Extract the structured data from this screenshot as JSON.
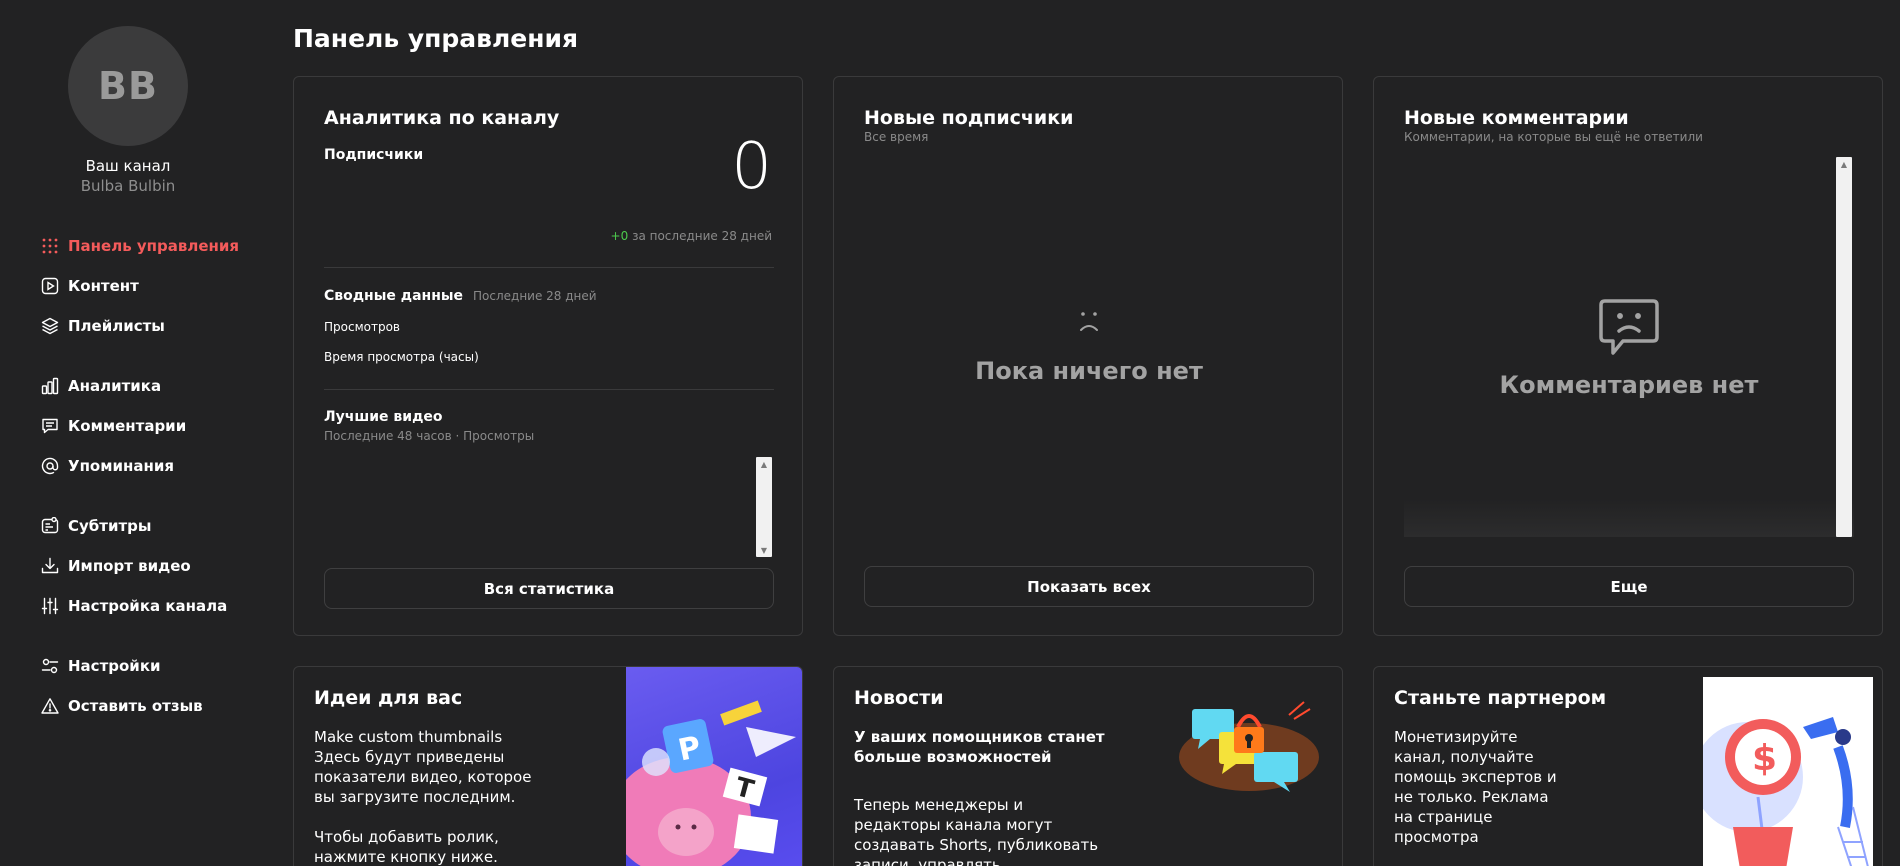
{
  "sidebar": {
    "avatar_initials": "BB",
    "channel_label": "Ваш канал",
    "channel_handle": "Bulba Bulbin",
    "items": [
      {
        "label": "Панель управления",
        "icon": "grid-dots-icon",
        "active": true
      },
      {
        "label": "Контент",
        "icon": "play-square-icon"
      },
      {
        "label": "Плейлисты",
        "icon": "layers-icon"
      },
      {
        "label": "Аналитика",
        "icon": "bar-chart-icon"
      },
      {
        "label": "Комментарии",
        "icon": "comment-icon"
      },
      {
        "label": "Упоминания",
        "icon": "at-sign-icon"
      },
      {
        "label": "Субтитры",
        "icon": "subtitles-icon"
      },
      {
        "label": "Импорт видео",
        "icon": "download-icon"
      },
      {
        "label": "Настройка канала",
        "icon": "sliders-icon"
      },
      {
        "label": "Настройки",
        "icon": "settings-toggle-icon"
      },
      {
        "label": "Оставить отзыв",
        "icon": "warning-triangle-icon"
      }
    ]
  },
  "page_title": "Панель управления",
  "analytics": {
    "title": "Аналитика по каналу",
    "subscribers_label": "Подписчики",
    "subscribers_count": "0",
    "delta": "+0",
    "delta_period": "за последние 28 дней",
    "summary_title": "Сводные данные",
    "summary_period": "Последние 28 дней",
    "views_label": "Просмотров",
    "watch_time_label": "Время просмотра (часы)",
    "best_videos_title": "Лучшие видео",
    "best_videos_sub": "Последние 48 часов · Просмотры",
    "all_stats_button": "Вся статистика"
  },
  "subscribers": {
    "title": "Новые подписчики",
    "subtitle": "Все время",
    "empty_text": "Пока ничего нет",
    "show_all_button": "Показать всех"
  },
  "comments": {
    "title": "Новые комментарии",
    "subtitle": "Комментарии, на которые вы ещё не ответили",
    "empty_text": "Комментариев нет",
    "more_button": "Еще"
  },
  "ideas": {
    "title": "Идеи для вас",
    "line1": "Make custom thumbnails",
    "body1": "Здесь будут приведены показатели видео, которое вы загрузите последним.",
    "body2": "Чтобы добавить ролик, нажмите кнопку ниже."
  },
  "news": {
    "title": "Новости",
    "headline": "У ваших помощников станет больше возможностей",
    "body": "Теперь менеджеры и редакторы канала могут создавать Shorts, публиковать записи, управлять плейлистами и оставлять"
  },
  "partner": {
    "title": "Станьте партнером",
    "body": "Монетизируйте канал, получайте помощь экспертов и не только. Реклама на странице просмотра"
  },
  "colors": {
    "background": "#222223",
    "accent_active": "#f45b5b",
    "positive": "#4cc94c",
    "card_border": "#3a3a3b"
  }
}
